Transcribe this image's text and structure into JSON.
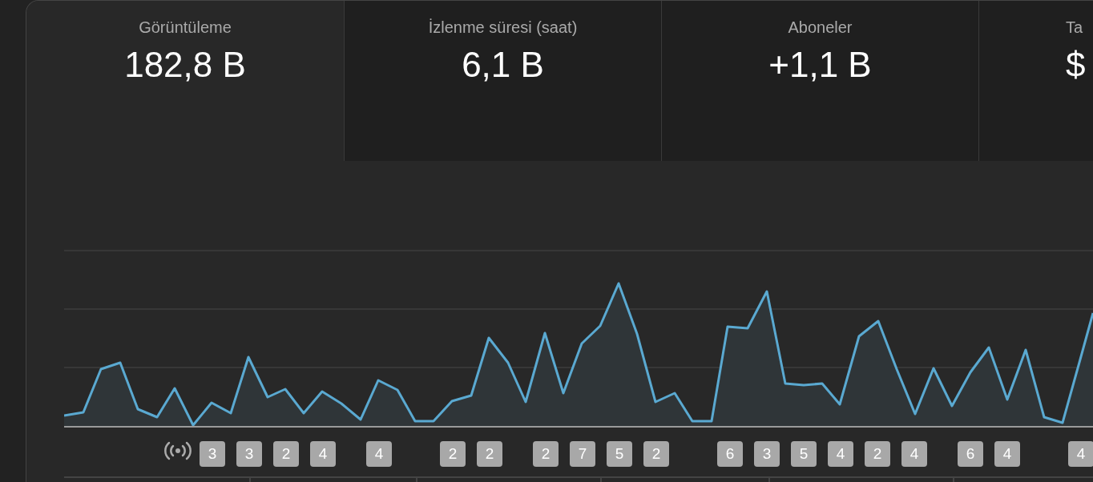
{
  "metric_tabs": [
    {
      "label": "Görüntüleme",
      "value": "182,8 B",
      "selected": true
    },
    {
      "label": "İzlenme süresi (saat)",
      "value": "6,1 B",
      "selected": false
    },
    {
      "label": "Aboneler",
      "value": "+1,1 B",
      "selected": false
    },
    {
      "label": "Ta",
      "value": "$",
      "selected": false
    }
  ],
  "video_markers": [
    "3",
    "3",
    "2",
    "4",
    "4",
    "2",
    "2",
    "2",
    "7",
    "5",
    "2",
    "6",
    "3",
    "5",
    "4",
    "2",
    "4",
    "6",
    "4",
    "4"
  ]
}
